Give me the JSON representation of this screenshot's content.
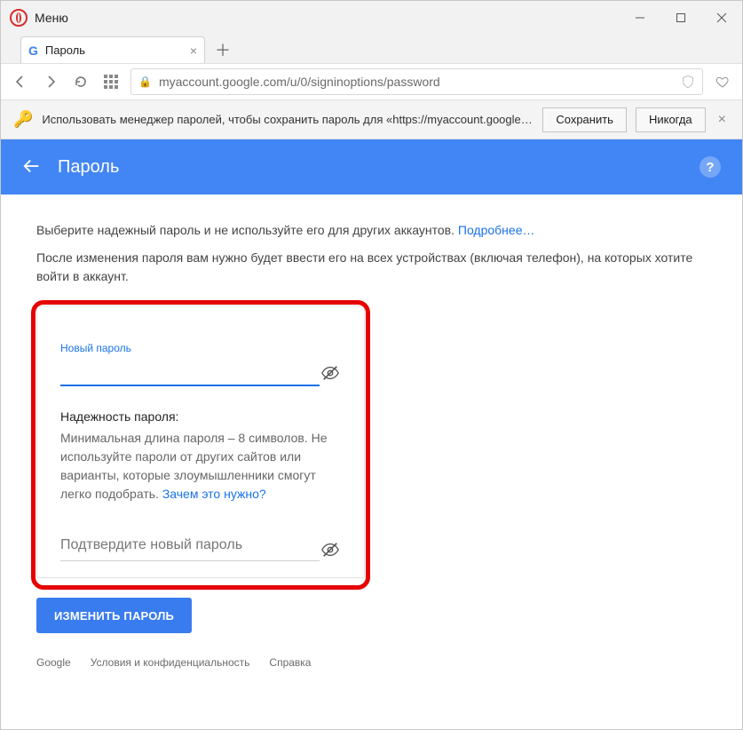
{
  "titlebar": {
    "menu": "Меню"
  },
  "tab": {
    "title": "Пароль"
  },
  "url": "myaccount.google.com/u/0/signinoptions/password",
  "pm_bar": {
    "text": "Использовать менеджер паролей, чтобы сохранить пароль для «https://myaccount.google.c…",
    "save": "Сохранить",
    "never": "Никогда"
  },
  "header": {
    "title": "Пароль"
  },
  "intro": {
    "line1_pre": "Выберите надежный пароль и не используйте его для других аккаунтов. ",
    "line1_link": "Подробнее…",
    "line2": "После изменения пароля вам нужно будет ввести его на всех устройствах (включая телефон), на которых хотите войти в аккаунт."
  },
  "form": {
    "new_password_label": "Новый пароль",
    "strength_title": "Надежность пароля:",
    "strength_text": "Минимальная длина пароля – 8 символов. Не используйте пароли от других сайтов или варианты, которые злоумышленники смогут легко подобрать. ",
    "strength_link": "Зачем это нужно?",
    "confirm_placeholder": "Подтвердите новый пароль",
    "submit": "ИЗМЕНИТЬ ПАРОЛЬ"
  },
  "footer": {
    "google": "Google",
    "privacy": "Условия и конфиденциальность",
    "help": "Справка"
  }
}
